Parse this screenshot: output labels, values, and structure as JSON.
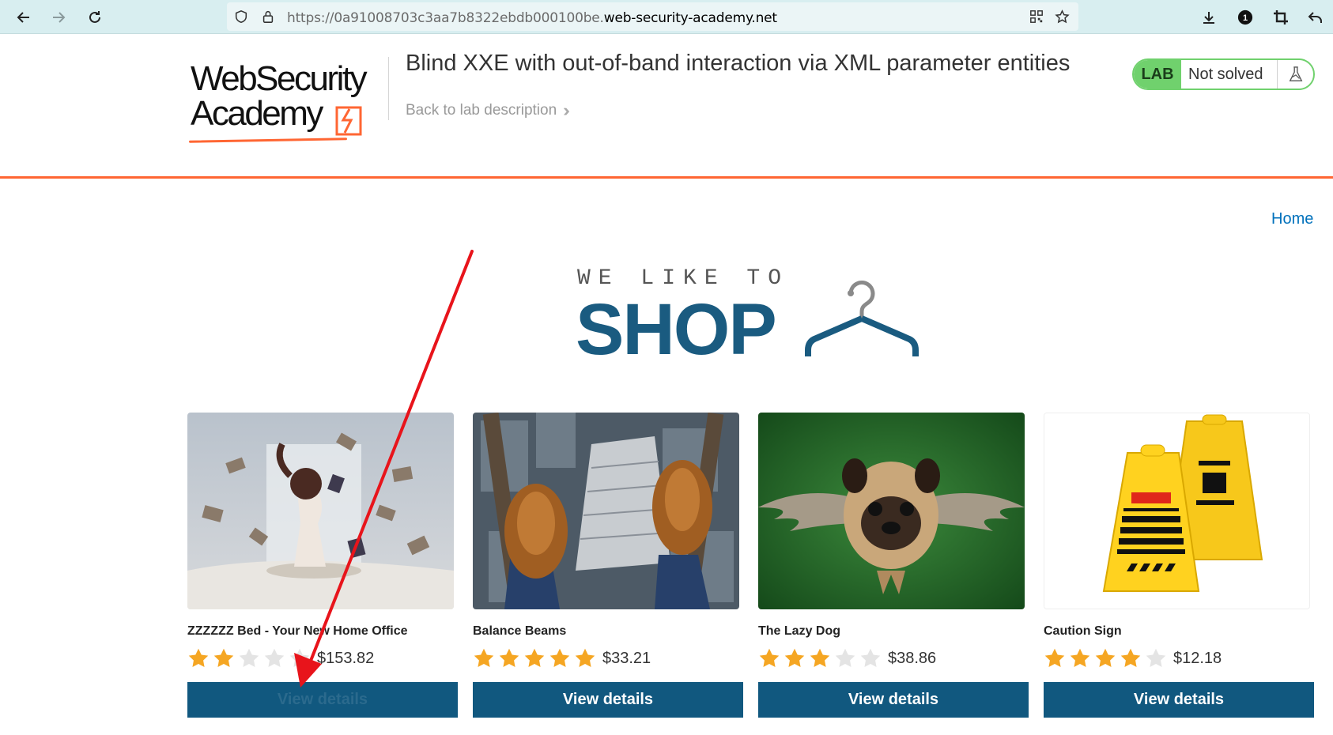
{
  "browser": {
    "url_prefix": "https://0a91008703c3aa7b8322ebdb000100be.",
    "url_domain": "web-security-academy.net",
    "notification_count": "1"
  },
  "lab": {
    "logo_line1": "WebSecurity",
    "logo_line2": "Academy",
    "title": "Blind XXE with out-of-band interaction via XML parameter entities",
    "back_link": "Back to lab description",
    "badge": "LAB",
    "status": "Not solved"
  },
  "nav": {
    "home": "Home"
  },
  "hero": {
    "small": "WE LIKE TO",
    "big": "SHOP"
  },
  "colors": {
    "accent": "#ff6633",
    "brand_blue": "#1a5b80",
    "button": "#11587f",
    "lab_green": "#70d16d",
    "star": "#f5a623"
  },
  "products": [
    {
      "name": "ZZZZZZ Bed - Your New Home Office",
      "price": "$153.82",
      "rating": 2,
      "button": "View details",
      "image": "woman-floating-books-image"
    },
    {
      "name": "Balance Beams",
      "price": "$33.21",
      "rating": 5,
      "button": "View details",
      "image": "feet-over-city-image"
    },
    {
      "name": "The Lazy Dog",
      "price": "$38.86",
      "rating": 3,
      "button": "View details",
      "image": "winged-pug-image"
    },
    {
      "name": "Caution Sign",
      "price": "$12.18",
      "rating": 4,
      "button": "View details",
      "image": "caution-sign-image"
    }
  ]
}
